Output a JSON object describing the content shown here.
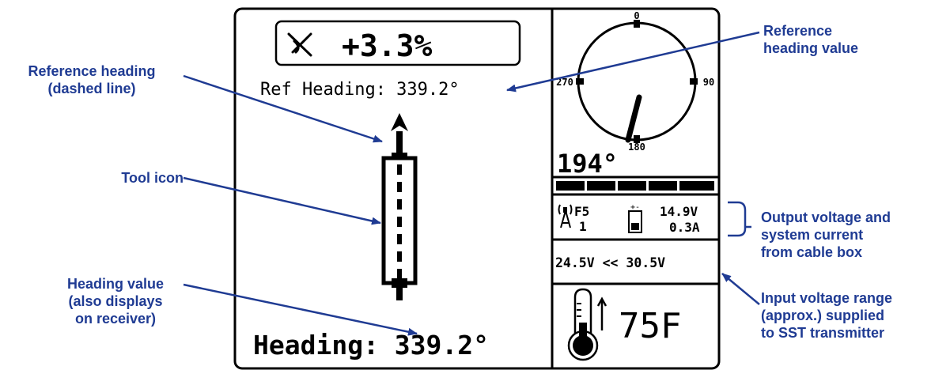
{
  "display": {
    "pitch_value": "+3.3%",
    "ref_heading_label": "Ref Heading: 339.2°",
    "heading_label": "Heading: 339.2°",
    "compass": {
      "north": "0",
      "east": "90",
      "south": "180",
      "west": "270",
      "heading_value": "194°"
    },
    "signal_bar_segments": 5,
    "status": {
      "frequency": "F5",
      "channel": "1",
      "output_voltage": "14.9V",
      "system_current": "0.3A"
    },
    "input_voltage_range": "24.5V << 30.5V",
    "temperature": "75F"
  },
  "annotations": {
    "reference_heading": [
      "Reference heading",
      "(dashed line)"
    ],
    "tool_icon": [
      "Tool icon"
    ],
    "heading_value": [
      "Heading value",
      "(also displays",
      "on receiver)"
    ],
    "reference_heading_value": [
      "Reference",
      "heading value"
    ],
    "output_voltage": [
      "Output voltage and",
      "system current",
      "from cable box"
    ],
    "input_voltage": [
      "Input voltage range",
      "(approx.) supplied",
      "to SST transmitter"
    ]
  },
  "colors": {
    "annotation": "#1f3b93",
    "display_ink": "#000000",
    "background": "#ffffff"
  }
}
